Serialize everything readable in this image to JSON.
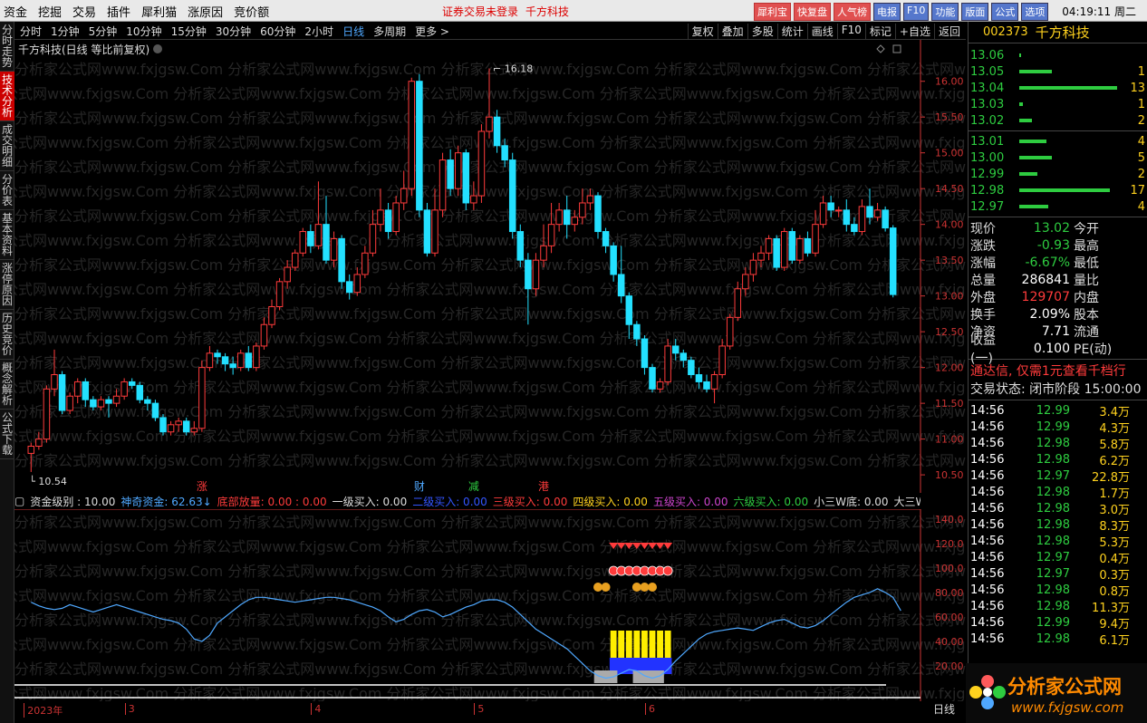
{
  "topbar": {
    "menu": [
      "资金",
      "挖掘",
      "交易",
      "插件",
      "犀利猫",
      "涨原因",
      "竞价额"
    ],
    "center": [
      "证券交易未登录",
      "千方科技"
    ],
    "right_buttons": [
      "犀利宝",
      "快复盘",
      "人气榜",
      "电报",
      "F10",
      "功能",
      "版面",
      "公式",
      "选项"
    ],
    "clock": "04:19:11 周二"
  },
  "left_tabs": [
    "分时走势",
    "技术分析",
    "成交明细",
    "分价表",
    "基本资料",
    "涨停原因",
    "历史竞价",
    "概念解析",
    "公式下载"
  ],
  "toolbar": {
    "periods": [
      "分时",
      "1分钟",
      "5分钟",
      "10分钟",
      "15分钟",
      "30分钟",
      "60分钟",
      "2小时",
      "日线",
      "多周期",
      "更多 >"
    ],
    "active_period": "日线",
    "tools": [
      "复权",
      "叠加",
      "多股",
      "统计",
      "画线",
      "F10",
      "标记",
      "+自选",
      "返回"
    ]
  },
  "chart_title": "千方科技(日线 等比前复权)",
  "chart_data": {
    "type": "candlestick",
    "y_axis_ticks": [
      "16.00",
      "15.50",
      "15.00",
      "14.50",
      "14.00",
      "13.50",
      "13.00",
      "12.50",
      "12.00",
      "11.50",
      "11.00",
      "10.50"
    ],
    "ylim": [
      10.4,
      16.3
    ],
    "high_label": "16.18",
    "low_label": "10.54",
    "candles": [
      [
        10.8,
        10.9,
        10.54,
        10.95
      ],
      [
        10.9,
        11.0,
        10.85,
        11.1
      ],
      [
        11.0,
        11.7,
        10.95,
        11.75
      ],
      [
        11.7,
        11.9,
        11.6,
        12.25
      ],
      [
        11.9,
        11.4,
        11.35,
        11.95
      ],
      [
        11.4,
        11.6,
        11.35,
        11.65
      ],
      [
        11.6,
        11.8,
        11.5,
        11.85
      ],
      [
        11.8,
        11.55,
        11.45,
        11.85
      ],
      [
        11.55,
        11.45,
        11.4,
        11.6
      ],
      [
        11.45,
        11.55,
        11.4,
        11.6
      ],
      [
        11.55,
        11.5,
        11.3,
        11.6
      ],
      [
        11.5,
        11.6,
        11.45,
        11.7
      ],
      [
        11.6,
        11.8,
        11.55,
        11.85
      ],
      [
        11.8,
        11.75,
        11.7,
        11.85
      ],
      [
        11.75,
        11.55,
        11.5,
        11.8
      ],
      [
        11.55,
        11.5,
        11.4,
        11.6
      ],
      [
        11.5,
        11.3,
        11.25,
        11.55
      ],
      [
        11.3,
        11.1,
        11.05,
        11.35
      ],
      [
        11.1,
        11.2,
        11.05,
        11.25
      ],
      [
        11.2,
        11.25,
        11.1,
        11.3
      ],
      [
        11.25,
        11.1,
        11.05,
        11.3
      ],
      [
        11.1,
        11.15,
        11.05,
        11.25
      ],
      [
        11.15,
        12.0,
        11.1,
        12.1
      ],
      [
        12.0,
        12.2,
        11.95,
        12.3
      ],
      [
        12.2,
        12.15,
        12.05,
        12.25
      ],
      [
        12.15,
        12.05,
        11.95,
        12.2
      ],
      [
        12.05,
        12.0,
        11.9,
        12.15
      ],
      [
        12.0,
        12.2,
        11.95,
        12.25
      ],
      [
        12.2,
        12.0,
        11.95,
        12.3
      ],
      [
        12.0,
        12.3,
        11.95,
        12.35
      ],
      [
        12.3,
        12.6,
        12.25,
        12.7
      ],
      [
        12.6,
        12.85,
        12.55,
        12.95
      ],
      [
        12.85,
        13.2,
        12.8,
        13.25
      ],
      [
        13.2,
        13.4,
        13.1,
        13.5
      ],
      [
        13.4,
        13.6,
        13.35,
        13.65
      ],
      [
        13.6,
        13.9,
        13.55,
        13.95
      ],
      [
        13.9,
        13.7,
        13.6,
        14.0
      ],
      [
        13.7,
        14.0,
        13.65,
        14.6
      ],
      [
        14.0,
        13.5,
        13.45,
        14.4
      ],
      [
        13.5,
        13.8,
        13.4,
        13.9
      ],
      [
        13.8,
        13.2,
        13.1,
        13.85
      ],
      [
        13.2,
        13.05,
        12.95,
        13.3
      ],
      [
        13.05,
        13.3,
        13.0,
        13.4
      ],
      [
        13.3,
        13.6,
        13.25,
        13.7
      ],
      [
        13.6,
        14.0,
        13.55,
        14.2
      ],
      [
        14.0,
        14.2,
        13.9,
        14.5
      ],
      [
        14.2,
        13.9,
        13.8,
        14.3
      ],
      [
        13.9,
        14.3,
        13.85,
        14.4
      ],
      [
        14.3,
        14.5,
        14.2,
        14.75
      ],
      [
        14.5,
        16.0,
        14.4,
        16.05
      ],
      [
        16.0,
        14.2,
        14.1,
        16.1
      ],
      [
        14.2,
        13.6,
        13.55,
        14.3
      ],
      [
        13.6,
        14.2,
        13.55,
        14.5
      ],
      [
        14.2,
        14.9,
        14.1,
        15.0
      ],
      [
        14.9,
        14.5,
        14.4,
        15.05
      ],
      [
        14.5,
        15.0,
        14.4,
        15.1
      ],
      [
        15.0,
        14.3,
        14.2,
        15.05
      ],
      [
        14.3,
        14.4,
        14.2,
        14.6
      ],
      [
        14.4,
        15.3,
        14.3,
        15.4
      ],
      [
        15.3,
        15.5,
        15.2,
        16.18
      ],
      [
        15.5,
        15.1,
        15.0,
        15.6
      ],
      [
        15.1,
        14.9,
        14.8,
        15.2
      ],
      [
        14.9,
        13.9,
        13.8,
        15.0
      ],
      [
        13.9,
        13.5,
        13.4,
        14.0
      ],
      [
        13.5,
        13.1,
        12.6,
        13.6
      ],
      [
        13.1,
        13.5,
        13.0,
        13.6
      ],
      [
        13.5,
        13.7,
        13.4,
        14.0
      ],
      [
        13.7,
        14.0,
        13.6,
        14.3
      ],
      [
        14.0,
        14.2,
        13.9,
        14.3
      ],
      [
        14.2,
        14.0,
        13.8,
        14.4
      ],
      [
        14.0,
        14.1,
        13.9,
        14.2
      ],
      [
        14.1,
        14.3,
        14.0,
        14.5
      ],
      [
        14.3,
        14.4,
        14.2,
        14.5
      ],
      [
        14.4,
        13.9,
        13.8,
        14.45
      ],
      [
        13.9,
        13.7,
        13.6,
        13.95
      ],
      [
        13.7,
        13.3,
        13.2,
        13.75
      ],
      [
        13.3,
        13.0,
        12.9,
        13.7
      ],
      [
        13.0,
        12.6,
        12.4,
        13.05
      ],
      [
        12.6,
        12.4,
        12.3,
        12.65
      ],
      [
        12.4,
        12.0,
        11.9,
        12.45
      ],
      [
        12.0,
        11.7,
        11.65,
        12.05
      ],
      [
        11.7,
        11.8,
        11.65,
        11.85
      ],
      [
        11.8,
        12.3,
        11.75,
        12.4
      ],
      [
        12.3,
        12.2,
        12.1,
        12.4
      ],
      [
        12.2,
        12.1,
        12.0,
        12.25
      ],
      [
        12.1,
        11.9,
        11.85,
        12.15
      ],
      [
        11.9,
        11.8,
        11.7,
        12.0
      ],
      [
        11.8,
        11.7,
        11.65,
        11.9
      ],
      [
        11.7,
        11.9,
        11.5,
        11.95
      ],
      [
        11.9,
        12.3,
        11.85,
        12.4
      ],
      [
        12.3,
        12.7,
        12.25,
        12.75
      ],
      [
        12.7,
        13.1,
        12.65,
        13.2
      ],
      [
        13.1,
        13.3,
        13.0,
        13.4
      ],
      [
        13.3,
        13.5,
        13.2,
        13.6
      ],
      [
        13.5,
        13.6,
        13.4,
        13.7
      ],
      [
        13.6,
        13.8,
        13.5,
        13.85
      ],
      [
        13.8,
        13.4,
        13.35,
        13.85
      ],
      [
        13.4,
        13.9,
        13.35,
        13.95
      ],
      [
        13.9,
        13.5,
        13.45,
        13.95
      ],
      [
        13.5,
        13.8,
        13.45,
        13.85
      ],
      [
        13.8,
        13.6,
        13.55,
        13.9
      ],
      [
        13.6,
        14.0,
        13.55,
        14.2
      ],
      [
        14.0,
        14.3,
        13.95,
        14.4
      ],
      [
        14.3,
        14.2,
        14.1,
        14.4
      ],
      [
        14.2,
        14.2,
        14.1,
        14.25
      ],
      [
        14.2,
        14.0,
        13.9,
        14.35
      ],
      [
        14.0,
        13.9,
        13.85,
        14.1
      ],
      [
        13.9,
        14.25,
        13.85,
        14.35
      ],
      [
        14.25,
        14.1,
        14.0,
        14.5
      ],
      [
        14.1,
        14.2,
        14.05,
        14.3
      ],
      [
        14.2,
        13.95,
        13.9,
        14.25
      ],
      [
        13.95,
        13.02,
        12.98,
        13.99
      ]
    ],
    "event_markers": [
      {
        "label": "涨",
        "index": 22,
        "color": "#ff3b3b"
      },
      {
        "label": "财",
        "index": 50,
        "color": "#4fa8ff"
      },
      {
        "label": "减",
        "index": 57,
        "color": "#2ecc40"
      },
      {
        "label": "港",
        "index": 66,
        "color": "#ff3b3b"
      }
    ],
    "x_axis_labels": [
      {
        "label": "2023年",
        "index": 0
      },
      {
        "label": "3",
        "index": 13
      },
      {
        "label": "4",
        "index": 37
      },
      {
        "label": "5",
        "index": 58
      },
      {
        "label": "6",
        "index": 80
      }
    ]
  },
  "indicator": {
    "items": [
      {
        "label": "资金级别 : 10.00",
        "color": "#dddddd"
      },
      {
        "label": "神奇资金: 62.63↓",
        "color": "#4fa8ff"
      },
      {
        "label": "底部放量: 0.00 : 0.00",
        "color": "#ff3b3b"
      },
      {
        "label": "一级买入: 0.00",
        "color": "#dddddd"
      },
      {
        "label": "二级买入: 0.00",
        "color": "#3355ff"
      },
      {
        "label": "三级买入: 0.00",
        "color": "#ff3b3b"
      },
      {
        "label": "四级买入: 0.00",
        "color": "#ffd21e"
      },
      {
        "label": "五级买入: 0.00",
        "color": "#cc44cc"
      },
      {
        "label": "六级买入: 0.00",
        "color": "#2ecc40"
      },
      {
        "label": "小三W底: 0.00",
        "color": "#dddddd"
      },
      {
        "label": "大三W底: 0.00",
        "color": "#dddddd"
      }
    ],
    "y_ticks": [
      "140.0",
      "120.0",
      "100.0",
      "80.00",
      "60.00",
      "40.00",
      "20.00"
    ],
    "ylim": [
      0,
      145
    ],
    "line_values": [
      72,
      69,
      67,
      66,
      67,
      70,
      68,
      66,
      64,
      66,
      68,
      70,
      68,
      66,
      64,
      62,
      60,
      58,
      57,
      55,
      50,
      42,
      40,
      45,
      55,
      60,
      65,
      70,
      74,
      76,
      76,
      75,
      74,
      73,
      72,
      73,
      74,
      75,
      76,
      76,
      75,
      74,
      72,
      70,
      68,
      65,
      60,
      56,
      58,
      62,
      65,
      66,
      64,
      60,
      62,
      65,
      68,
      70,
      73,
      74,
      74,
      72,
      68,
      62,
      56,
      50,
      46,
      42,
      38,
      34,
      28,
      22,
      16,
      12,
      10,
      11,
      14,
      17,
      16,
      12,
      10,
      12,
      17,
      24,
      30,
      36,
      42,
      46,
      48,
      49,
      50,
      51,
      50,
      49,
      52,
      55,
      57,
      58,
      55,
      52,
      51,
      53,
      57,
      62,
      67,
      72,
      76,
      78,
      80,
      83,
      80,
      76,
      65
    ]
  },
  "right_panel": {
    "code": "002373",
    "name": "千方科技",
    "sells": [
      {
        "price": "13.06",
        "bar": 2,
        "vol": ""
      },
      {
        "price": "13.05",
        "bar": 36,
        "vol": "1"
      },
      {
        "price": "13.04",
        "bar": 108,
        "vol": "13"
      },
      {
        "price": "13.03",
        "bar": 4,
        "vol": "1"
      },
      {
        "price": "13.02",
        "bar": 14,
        "vol": "2"
      }
    ],
    "buys": [
      {
        "price": "13.01",
        "bar": 30,
        "vol": "4"
      },
      {
        "price": "13.00",
        "bar": 36,
        "vol": "5"
      },
      {
        "price": "12.99",
        "bar": 20,
        "vol": "2"
      },
      {
        "price": "12.98",
        "bar": 100,
        "vol": "17"
      },
      {
        "price": "12.97",
        "bar": 32,
        "vol": "4"
      }
    ],
    "quotes": [
      {
        "l": "现价",
        "v": "13.02",
        "vc": "green",
        "l2": "今开"
      },
      {
        "l": "涨跌",
        "v": "-0.93",
        "vc": "green",
        "l2": "最高"
      },
      {
        "l": "涨幅",
        "v": "-6.67%",
        "vc": "green",
        "l2": "最低"
      },
      {
        "l": "总量",
        "v": "286841",
        "vc": "white",
        "l2": "量比"
      },
      {
        "l": "外盘",
        "v": "129707",
        "vc": "red",
        "l2": "内盘"
      },
      {
        "l": "换手",
        "v": "2.09%",
        "vc": "white",
        "l2": "股本"
      },
      {
        "l": "净资",
        "v": "7.71",
        "vc": "white",
        "l2": "流通"
      },
      {
        "l": "收益(一)",
        "v": "0.100",
        "vc": "white",
        "l2": "PE(动)"
      }
    ],
    "ad": "通达信, 仅需1元查看千档行",
    "status": "交易状态: 闭市阶段 15:00:00",
    "ticks": [
      {
        "t": "14:56",
        "p": "12.99",
        "q": "3.4万"
      },
      {
        "t": "14:56",
        "p": "12.99",
        "q": "4.3万"
      },
      {
        "t": "14:56",
        "p": "12.98",
        "q": "5.8万"
      },
      {
        "t": "14:56",
        "p": "12.98",
        "q": "6.2万"
      },
      {
        "t": "14:56",
        "p": "12.97",
        "q": "22.8万"
      },
      {
        "t": "14:56",
        "p": "12.98",
        "q": "1.7万"
      },
      {
        "t": "14:56",
        "p": "12.98",
        "q": "3.0万"
      },
      {
        "t": "14:56",
        "p": "12.98",
        "q": "8.3万"
      },
      {
        "t": "14:56",
        "p": "12.98",
        "q": "5.3万"
      },
      {
        "t": "14:56",
        "p": "12.97",
        "q": "0.4万"
      },
      {
        "t": "14:56",
        "p": "12.97",
        "q": "0.3万"
      },
      {
        "t": "14:56",
        "p": "12.98",
        "q": "0.8万"
      },
      {
        "t": "14:56",
        "p": "12.98",
        "q": "11.3万"
      },
      {
        "t": "14:56",
        "p": "12.99",
        "q": "9.4万"
      },
      {
        "t": "14:56",
        "p": "12.98",
        "q": "6.1万"
      }
    ]
  },
  "watermark_text": "分析家公式网www.fxjgsw.Com",
  "logo": {
    "title": "分析家公式网",
    "url": "www.fxjgsw.com"
  },
  "period_label": "日线",
  "colors": {
    "up": "#ff3b3b",
    "down": "#23e0ff",
    "line": "#4fa8ff",
    "axis": "#c33"
  }
}
